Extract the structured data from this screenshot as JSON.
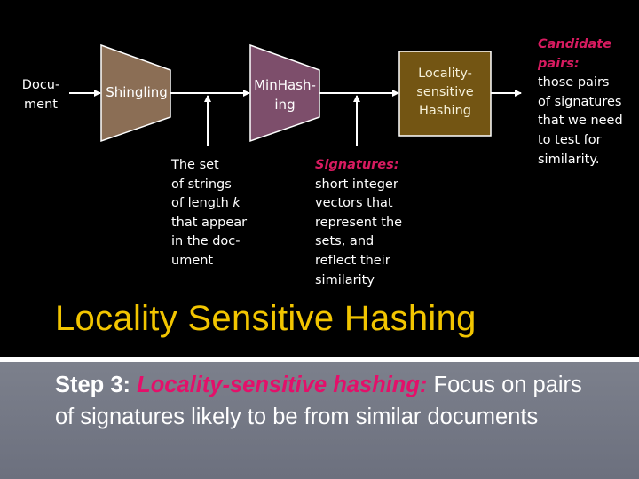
{
  "slide": {
    "title": "Locality Sensitive Hashing",
    "colors": {
      "background_top": "#000000",
      "title": "#f2c500",
      "accent_pink": "#d81b60",
      "shingling_fill": "#8b6e55",
      "minhashing_fill": "#7d4e6b",
      "lsh_fill": "#735513",
      "body_bg": "#74788a"
    }
  },
  "diagram": {
    "input_label": "Docu-\nment",
    "stages": [
      {
        "id": "shingling",
        "label": "Shingling",
        "shape": "trapezoid"
      },
      {
        "id": "minhashing",
        "label": "Min­Hash-\ning",
        "shape": "trapezoid"
      },
      {
        "id": "lsh",
        "label": "Locality-\nsensitive\nHashing",
        "shape": "box"
      }
    ],
    "annotations": {
      "shingles": {
        "text": "The set\nof strings\nof length k\nthat appear\nin the doc-\nument"
      },
      "signatures": {
        "heading": "Signatures:",
        "text": "short integer\nvectors that\nrepresent the\nsets, and\nreflect their\nsimilarity"
      },
      "candidates": {
        "heading": "Candidate\npairs:",
        "text": "those pairs\nof signatures\nthat we need\nto test for\nsimilarity."
      }
    }
  },
  "body": {
    "step_label": "Step 3:",
    "step_emphasis": "Locality-sensitive hashing:",
    "step_text": " Focus on pairs of signatures likely to be from similar documents"
  }
}
